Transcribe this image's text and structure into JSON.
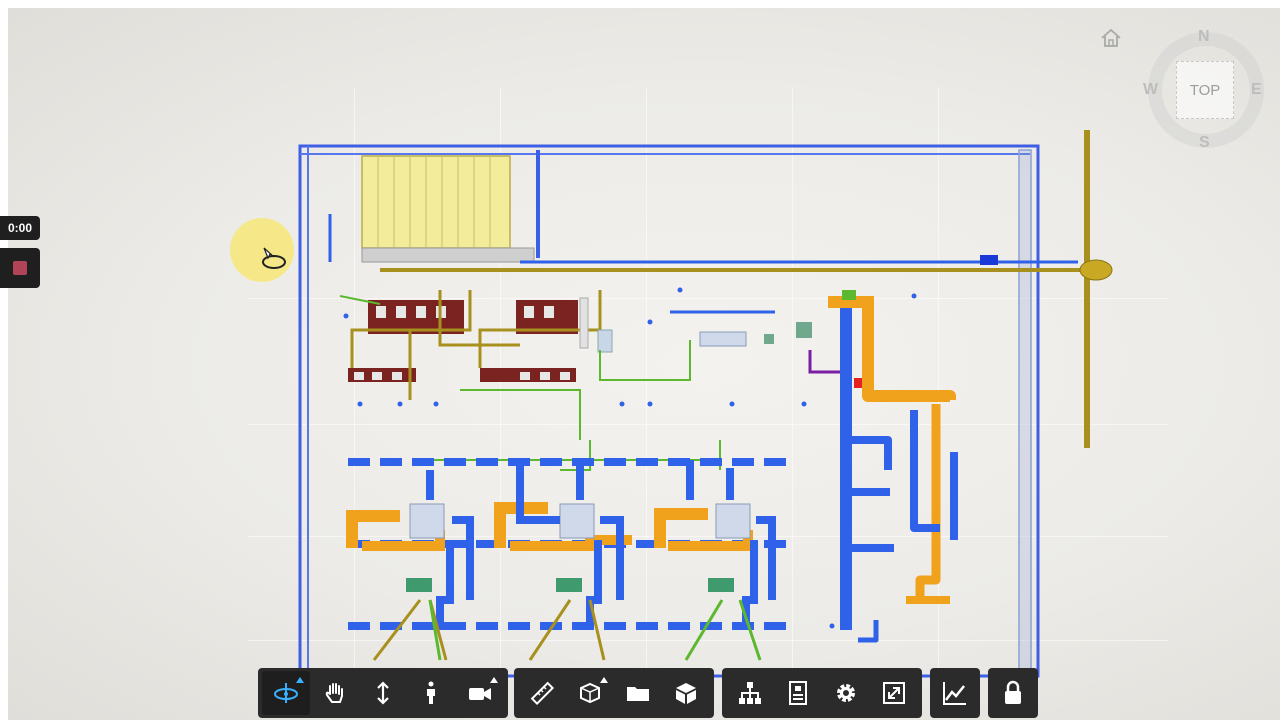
{
  "recorder": {
    "time": "0:00"
  },
  "viewcube": {
    "face": "TOP",
    "north": "N",
    "south": "S",
    "east": "E",
    "west": "W"
  },
  "colors": {
    "toolbar_bg": "#2b2b2b",
    "active_icon": "#3ab0ff",
    "pipe_blue": "#2f62e8",
    "pipe_orange": "#f0a21c",
    "pipe_olive": "#a8901e",
    "pipe_green": "#5cb82e",
    "tank_yellow": "#f3ec9a"
  },
  "toolbar": {
    "groups": [
      {
        "name": "navigation",
        "buttons": [
          {
            "id": "orbit",
            "icon": "orbit-icon",
            "active": true,
            "flyout": true
          },
          {
            "id": "pan",
            "icon": "pan-hand-icon",
            "active": false,
            "flyout": false
          },
          {
            "id": "zoom",
            "icon": "zoom-vertical-arrows-icon",
            "active": false,
            "flyout": false
          },
          {
            "id": "first-person",
            "icon": "person-icon",
            "active": false,
            "flyout": false
          },
          {
            "id": "camera",
            "icon": "camera-icon",
            "active": false,
            "flyout": true
          }
        ]
      },
      {
        "name": "analysis",
        "buttons": [
          {
            "id": "measure",
            "icon": "ruler-icon",
            "active": false,
            "flyout": false
          },
          {
            "id": "section",
            "icon": "section-box-icon",
            "active": false,
            "flyout": true
          },
          {
            "id": "explode",
            "icon": "folder-icon",
            "active": false,
            "flyout": false
          },
          {
            "id": "model-browser",
            "icon": "cube-icon",
            "active": false,
            "flyout": false
          }
        ]
      },
      {
        "name": "settings",
        "buttons": [
          {
            "id": "structure",
            "icon": "tree-structure-icon",
            "active": false,
            "flyout": false
          },
          {
            "id": "properties",
            "icon": "properties-icon",
            "active": false,
            "flyout": false
          },
          {
            "id": "settings",
            "icon": "gear-icon",
            "active": false,
            "flyout": false
          },
          {
            "id": "fullscreen",
            "icon": "fullscreen-icon",
            "active": false,
            "flyout": false
          }
        ]
      },
      {
        "name": "charts",
        "buttons": [
          {
            "id": "chart",
            "icon": "line-chart-icon",
            "active": false,
            "flyout": false
          }
        ]
      },
      {
        "name": "lock",
        "buttons": [
          {
            "id": "lock",
            "icon": "lock-icon",
            "active": false,
            "flyout": false
          }
        ]
      }
    ]
  }
}
